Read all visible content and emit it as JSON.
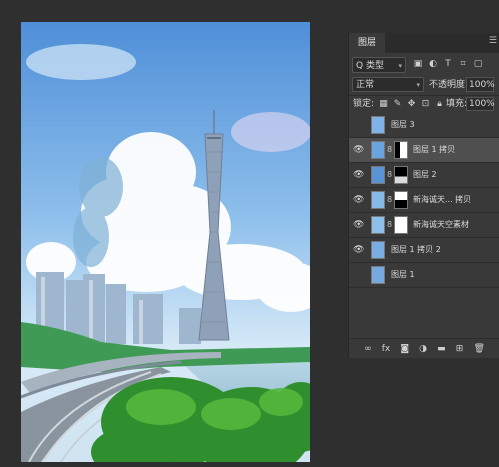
{
  "panel": {
    "tab_label": "图层",
    "menu_label": "☰",
    "filter": {
      "label": "Q 类型",
      "icons": [
        "image-filter-icon",
        "adjustment-filter-icon",
        "type-filter-icon",
        "shape-filter-icon",
        "smart-object-filter-icon"
      ]
    },
    "blend_mode": "正常",
    "opacity_label": "不透明度:",
    "opacity_value": "100%",
    "lock_label": "锁定:",
    "fill_label": "填充:",
    "fill_value": "100%",
    "layers": [
      {
        "name": "图层 3",
        "visible": false,
        "selected": false,
        "has_mask": false,
        "thumb_color": "#7fb2e6"
      },
      {
        "name": "图层 1 拷贝",
        "visible": true,
        "selected": true,
        "has_mask": true,
        "thumb_color": "#6aa3de"
      },
      {
        "name": "图层 2",
        "visible": true,
        "selected": false,
        "has_mask": true,
        "thumb_color": "#5b93d4"
      },
      {
        "name": "新海诚天... 拷贝",
        "visible": true,
        "selected": false,
        "has_mask": true,
        "thumb_color": "#86b9e8"
      },
      {
        "name": "新海诚天空素材",
        "visible": true,
        "selected": false,
        "has_mask": true,
        "thumb_color": "#8ebfe9"
      },
      {
        "name": "图层 1 拷贝 2",
        "visible": true,
        "selected": false,
        "has_mask": false,
        "thumb_color": "#7aaee2"
      },
      {
        "name": "图层 1",
        "visible": false,
        "selected": false,
        "has_mask": false,
        "thumb_color": "#76a9de"
      }
    ],
    "footer_icons": [
      "link-icon",
      "fx-icon",
      "add-mask-icon",
      "adjustment-icon",
      "group-icon",
      "new-layer-icon",
      "delete-icon"
    ]
  },
  "colors": {
    "background": "#2f2f2f",
    "panel": "#393939",
    "selected_row": "#4f4f4f"
  }
}
